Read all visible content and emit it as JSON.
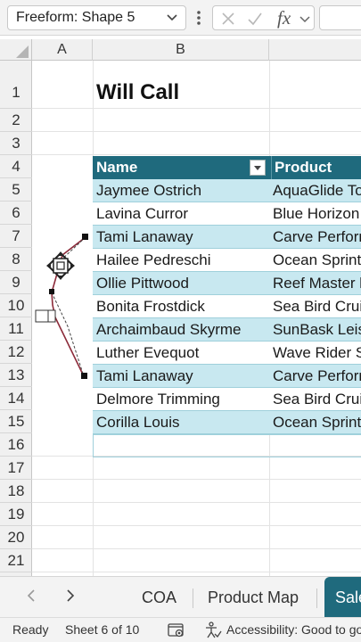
{
  "formula_bar": {
    "name_box": "Freeform: Shape 5",
    "fx_label": "fx",
    "formula": ""
  },
  "columns": [
    "A",
    "B"
  ],
  "rows": [
    "1",
    "2",
    "3",
    "4",
    "5",
    "6",
    "7",
    "8",
    "9",
    "10",
    "11",
    "12",
    "13",
    "14",
    "15",
    "16",
    "17",
    "18",
    "19",
    "20",
    "21"
  ],
  "sheet": {
    "title": "Will Call",
    "table": {
      "headers": [
        "Name",
        "Product"
      ],
      "rows": [
        [
          "Jaymee Ostrich",
          "AquaGlide To"
        ],
        [
          "Lavina Curror",
          "Blue Horizon"
        ],
        [
          "Tami Lanaway",
          "Carve Perforr"
        ],
        [
          "Hailee Pedreschi",
          "Ocean Sprint"
        ],
        [
          "Ollie Pittwood",
          "Reef Master l"
        ],
        [
          "Bonita Frostdick",
          "Sea Bird Crui"
        ],
        [
          "Archaimbaud Skyrme",
          "SunBask Leis"
        ],
        [
          "Luther Evequot",
          "Wave Rider S"
        ],
        [
          "Tami Lanaway",
          "Carve Perforr"
        ],
        [
          "Delmore Trimming",
          "Sea Bird Crui"
        ],
        [
          "Corilla Louis",
          "Ocean Sprint"
        ]
      ]
    }
  },
  "sheet_tabs": {
    "tabs": [
      "COA",
      "Product Map",
      "Sale"
    ],
    "active": "Sale"
  },
  "status_bar": {
    "ready": "Ready",
    "sheet_position": "Sheet 6 of 10",
    "accessibility": "Accessibility: Good to go"
  },
  "colors": {
    "table_header": "#1f6a7d",
    "band_row": "#c8e8f0",
    "active_tab": "#1f6a7d"
  }
}
